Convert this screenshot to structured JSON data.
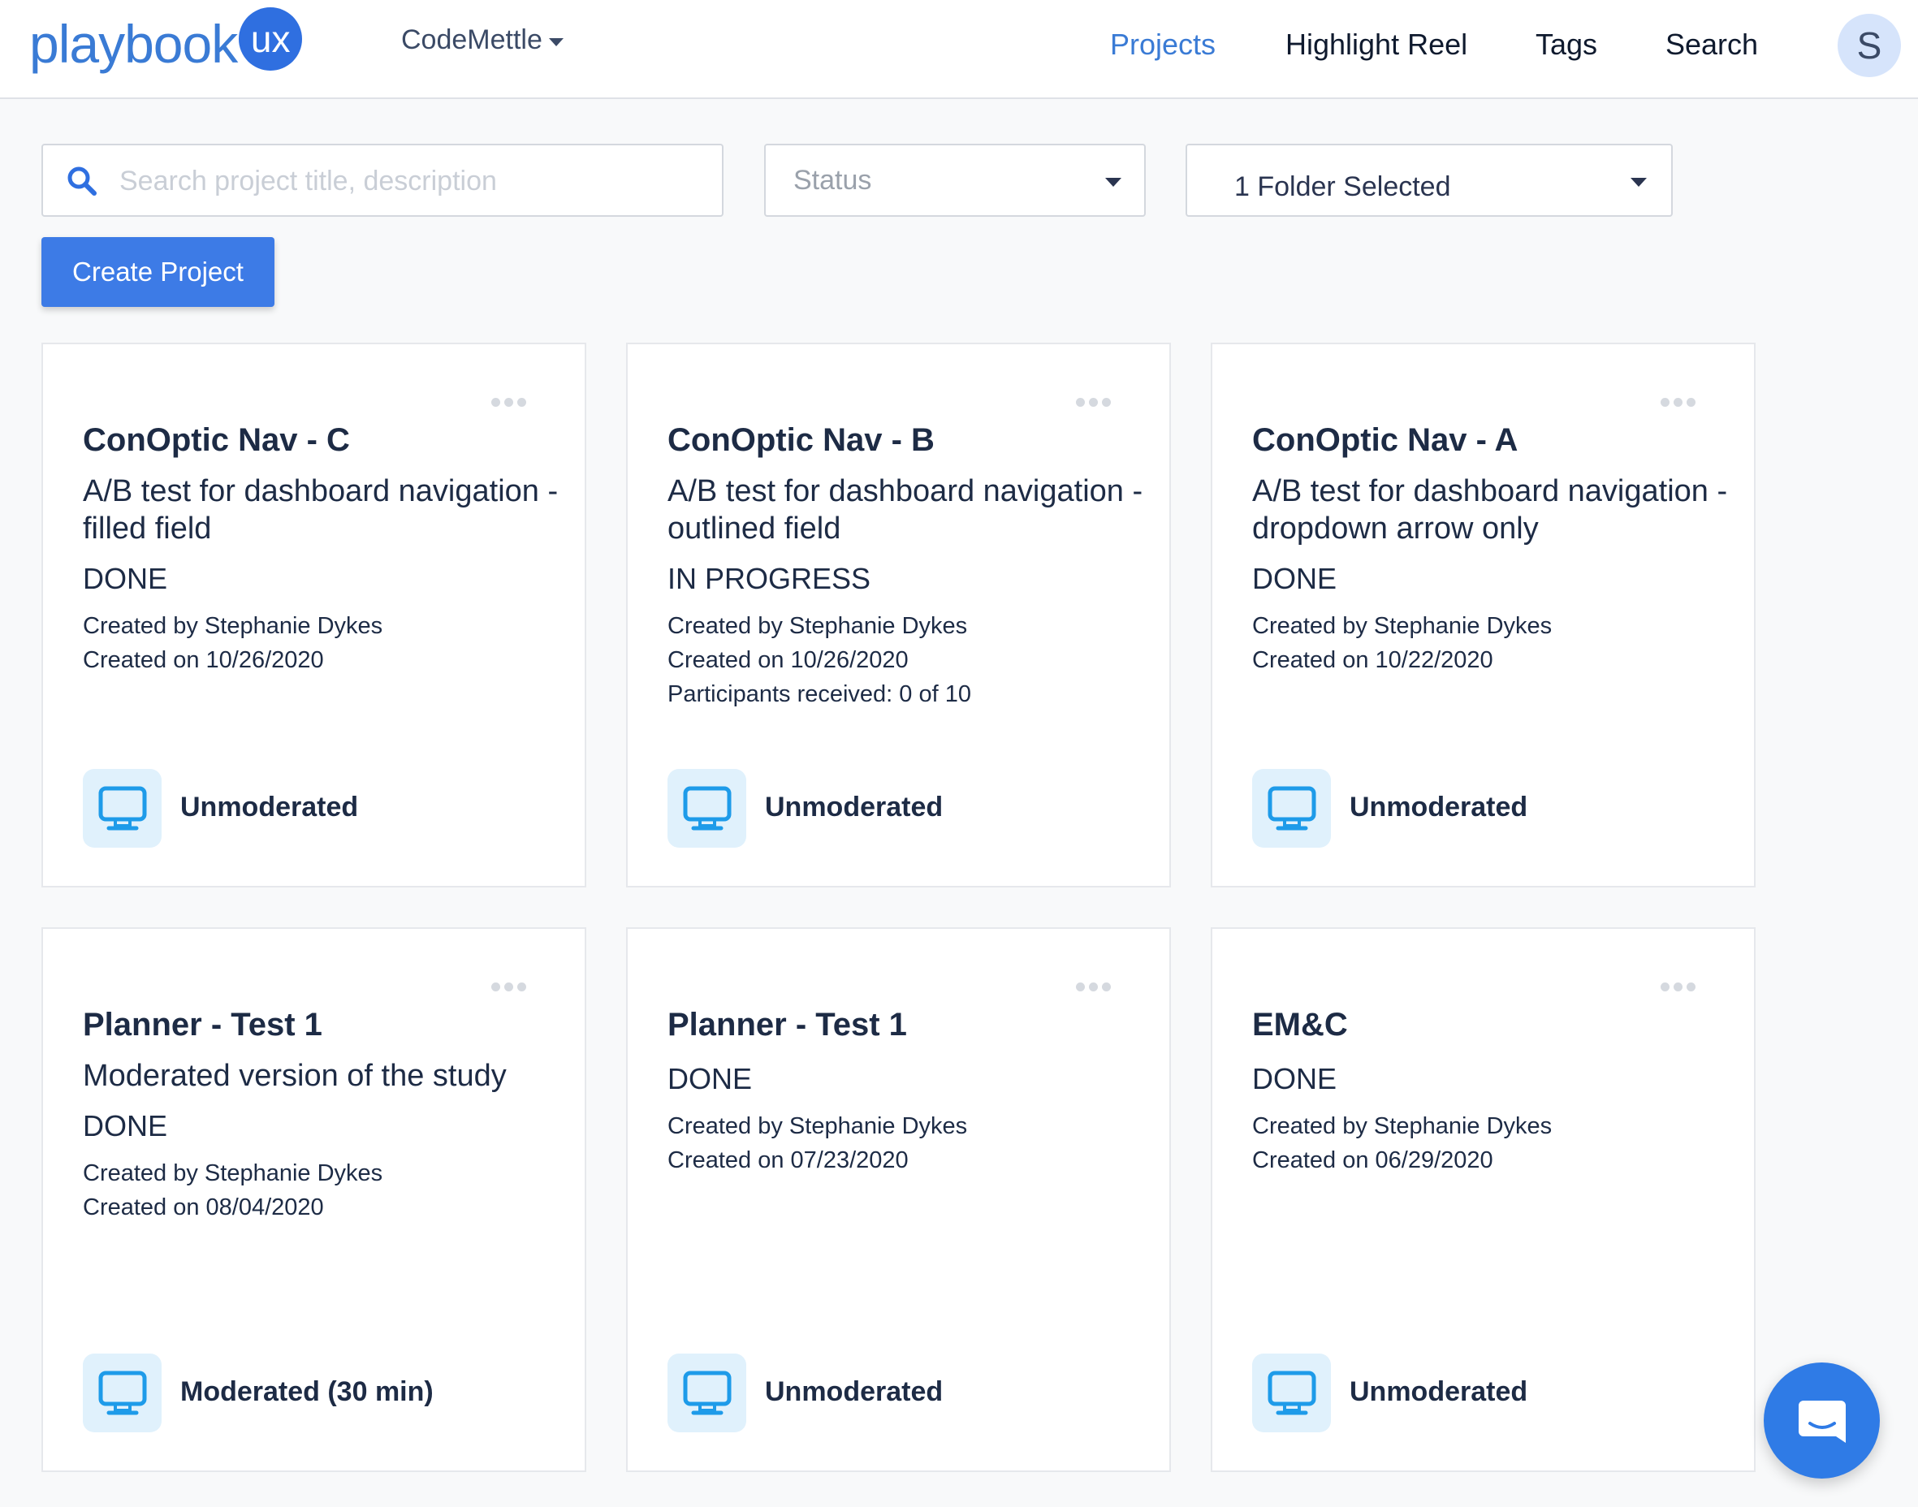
{
  "header": {
    "logo_text": "playbook",
    "logo_badge": "ux",
    "org": "CodeMettle",
    "nav": [
      "Projects",
      "Highlight Reel",
      "Tags",
      "Search"
    ],
    "active_nav": "Projects",
    "avatar_initial": "S"
  },
  "filters": {
    "search_placeholder": "Search project title, description",
    "status_label": "Status",
    "folder_label": "1 Folder Selected"
  },
  "actions": {
    "create_label": "Create Project"
  },
  "projects": [
    {
      "title": "ConOptic Nav - C",
      "description": "A/B test for dashboard navigation - filled field",
      "status": "DONE",
      "meta": [
        "Created by Stephanie Dykes",
        "Created on 10/26/2020"
      ],
      "type": "Unmoderated"
    },
    {
      "title": "ConOptic Nav - B",
      "description": "A/B test for dashboard navigation - outlined field",
      "status": "IN PROGRESS",
      "meta": [
        "Created by Stephanie Dykes",
        "Created on 10/26/2020",
        "Participants received: 0 of 10"
      ],
      "type": "Unmoderated"
    },
    {
      "title": "ConOptic Nav - A",
      "description": "A/B test for dashboard navigation - dropdown arrow only",
      "status": "DONE",
      "meta": [
        "Created by Stephanie Dykes",
        "Created on 10/22/2020"
      ],
      "type": "Unmoderated"
    },
    {
      "title": "Planner - Test 1",
      "description": "Moderated version of the study",
      "status": "DONE",
      "meta": [
        "Created by Stephanie Dykes",
        "Created on 08/04/2020"
      ],
      "type": "Moderated (30 min)"
    },
    {
      "title": "Planner - Test 1",
      "description": "",
      "status": "DONE",
      "meta": [
        "Created by Stephanie Dykes",
        "Created on 07/23/2020"
      ],
      "type": "Unmoderated"
    },
    {
      "title": "EM&C",
      "description": "",
      "status": "DONE",
      "meta": [
        "Created by Stephanie Dykes",
        "Created on 06/29/2020"
      ],
      "type": "Unmoderated"
    }
  ],
  "icons": {
    "search": "search-icon",
    "monitor": "monitor-icon",
    "more": "more-options-icon",
    "chat": "chat-icon"
  },
  "colors": {
    "brand": "#3a7bd5",
    "button": "#3d7be6",
    "text": "#1d2b45",
    "icon_bg": "#e0f1fc"
  }
}
